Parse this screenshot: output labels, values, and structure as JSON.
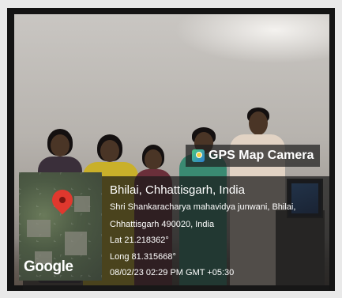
{
  "badge": {
    "title": "GPS Map Camera",
    "icon": "gps-map-camera-icon"
  },
  "location": {
    "title": "Bhilai, Chhattisgarh, India",
    "address_line1": "Shri Shankaracharya mahavidya junwani, Bhilai,",
    "address_line2": "Chhattisgarh 490020, India",
    "latitude": "Lat 21.218362°",
    "longitude": "Long 81.315668°",
    "timestamp": "08/02/23 02:29 PM GMT +05:30"
  },
  "map": {
    "logo_text": "Google",
    "pin_icon": "map-pin-icon",
    "pin_color": "#e0382e"
  }
}
